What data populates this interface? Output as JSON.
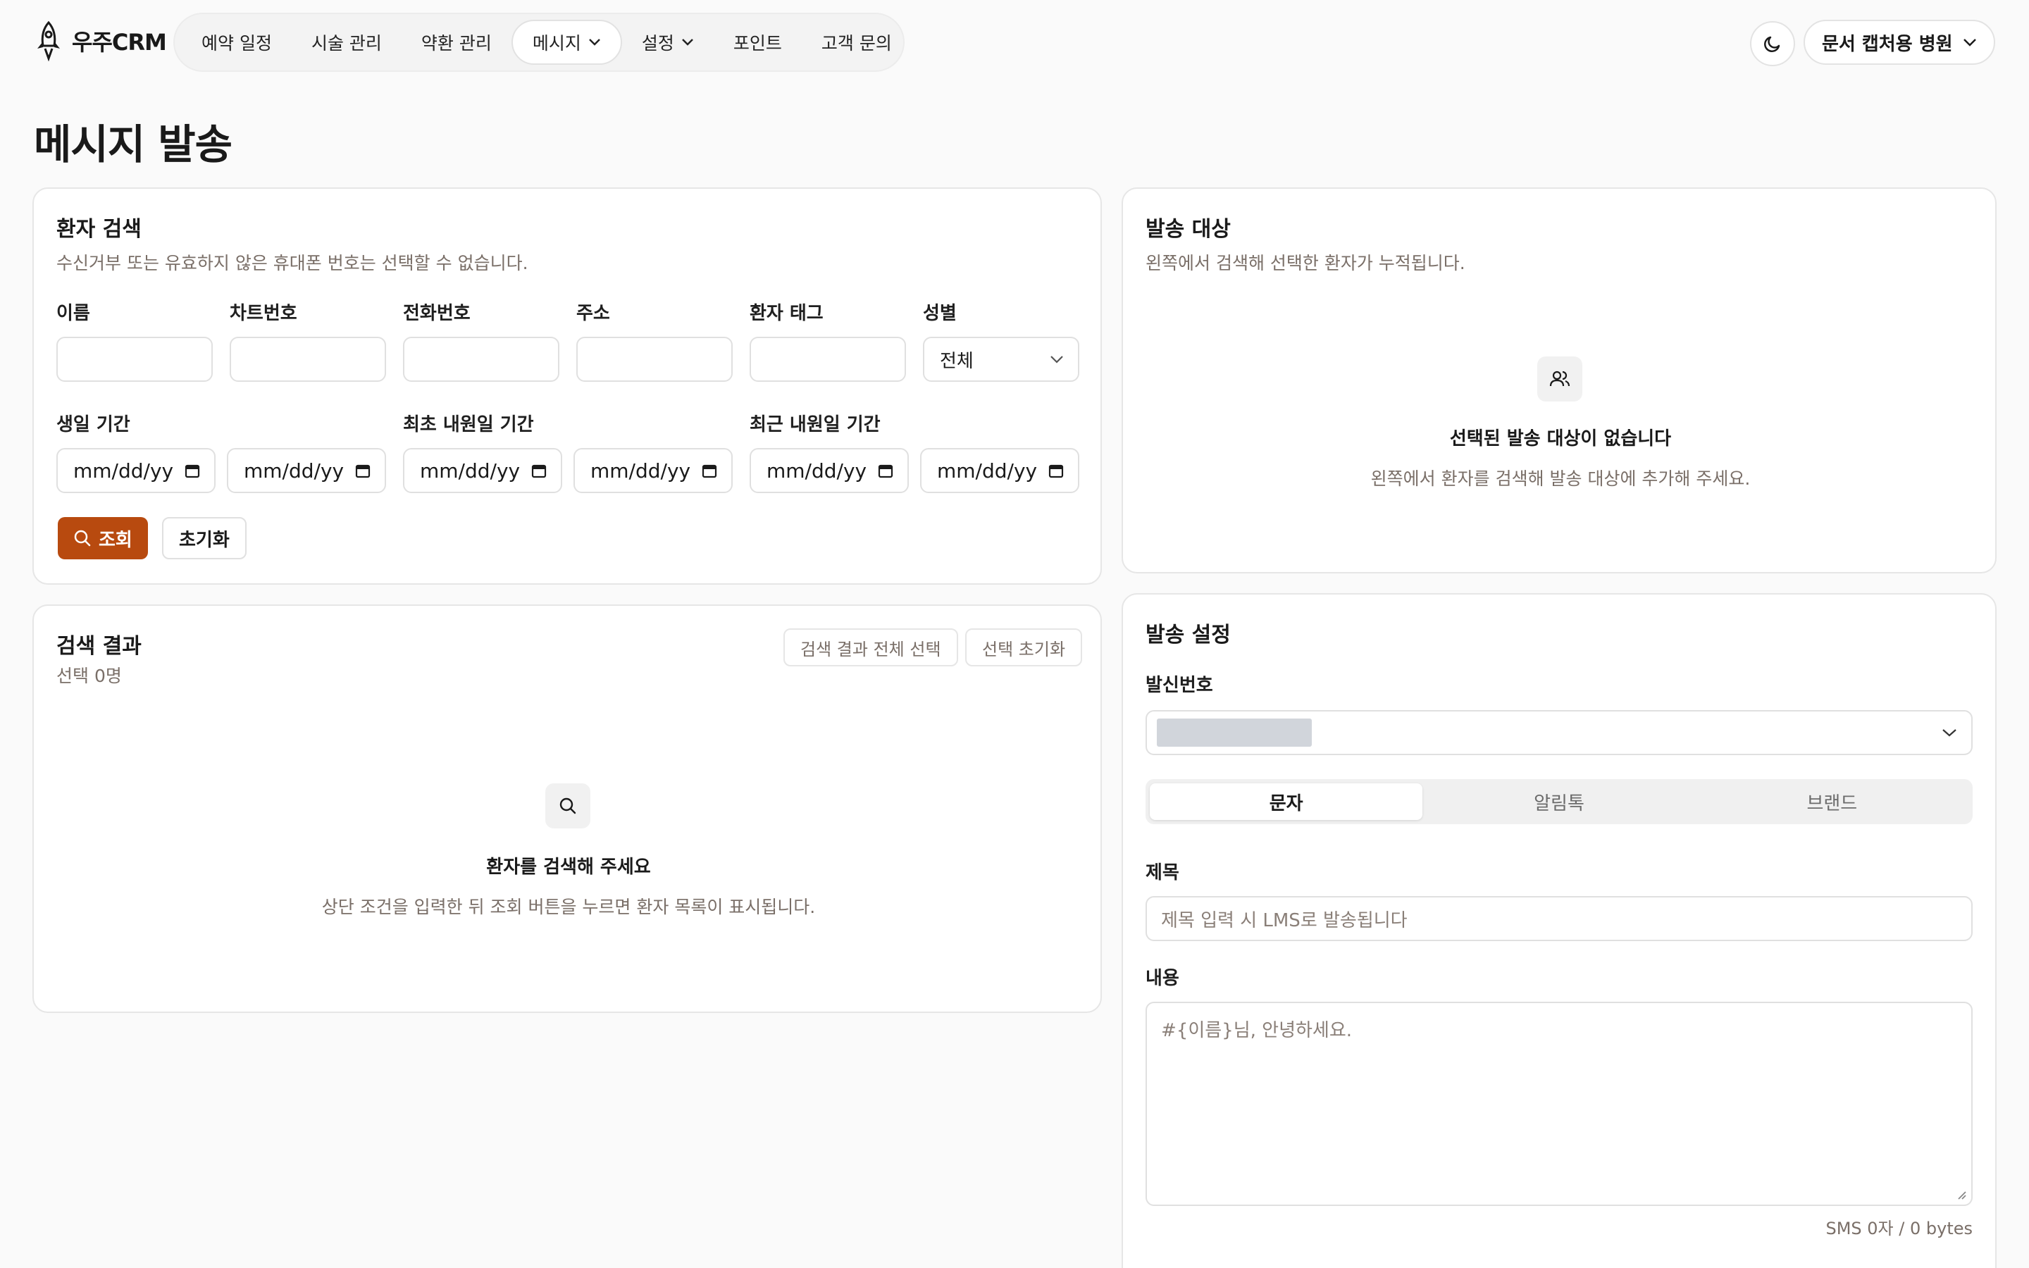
{
  "app": {
    "brand": "우주CRM",
    "clinic": "문서 캡처용 병원"
  },
  "nav": [
    {
      "label": "예약 일정"
    },
    {
      "label": "시술 관리"
    },
    {
      "label": "약환 관리"
    },
    {
      "label": "메시지",
      "dropdown": true,
      "active": true
    },
    {
      "label": "설정",
      "dropdown": true
    },
    {
      "label": "포인트"
    },
    {
      "label": "고객 문의"
    }
  ],
  "page": {
    "title": "메시지 발송"
  },
  "search": {
    "title": "환자 검색",
    "subtitle": "수신거부 또는 유효하지 않은 휴대폰 번호는 선택할 수 없습니다.",
    "fields": {
      "name": "이름",
      "chart": "차트번호",
      "phone": "전화번호",
      "address": "주소",
      "tag": "환자 태그",
      "gender": "성별"
    },
    "gender_value": "전체",
    "birthday_label": "생일 기간",
    "first_visit_label": "최초 내원일 기간",
    "last_visit_label": "최근 내원일 기간",
    "date_placeholder": "mm/dd/yy",
    "search_button": "조회",
    "reset_button": "초기화"
  },
  "results": {
    "title": "검색 결과",
    "count": "선택 0명",
    "select_all": "검색 결과 전체 선택",
    "clear_selection": "선택 초기화",
    "empty_title": "환자를 검색해 주세요",
    "empty_sub": "상단 조건을 입력한 뒤 조회 버튼을 누르면 환자 목록이 표시됩니다."
  },
  "targets": {
    "title": "발송 대상",
    "subtitle": "왼쪽에서 검색해 선택한 환자가 누적됩니다.",
    "empty_title": "선택된 발송 대상이 없습니다",
    "empty_sub": "왼쪽에서 환자를 검색해 발송 대상에 추가해 주세요."
  },
  "settings": {
    "title": "발송 설정",
    "sender_label": "발신번호",
    "tabs": [
      "문자",
      "알림톡",
      "브랜드"
    ],
    "active_tab": 0,
    "subject_label": "제목",
    "subject_placeholder": "제목 입력 시 LMS로 발송됩니다",
    "content_label": "내용",
    "content_placeholder": "#{이름}님, 안녕하세요.",
    "counter": "SMS 0자 / 0 bytes"
  },
  "colors": {
    "primary": "#b84a0f",
    "muted_text": "#7a6f68",
    "background": "#fafafa"
  }
}
